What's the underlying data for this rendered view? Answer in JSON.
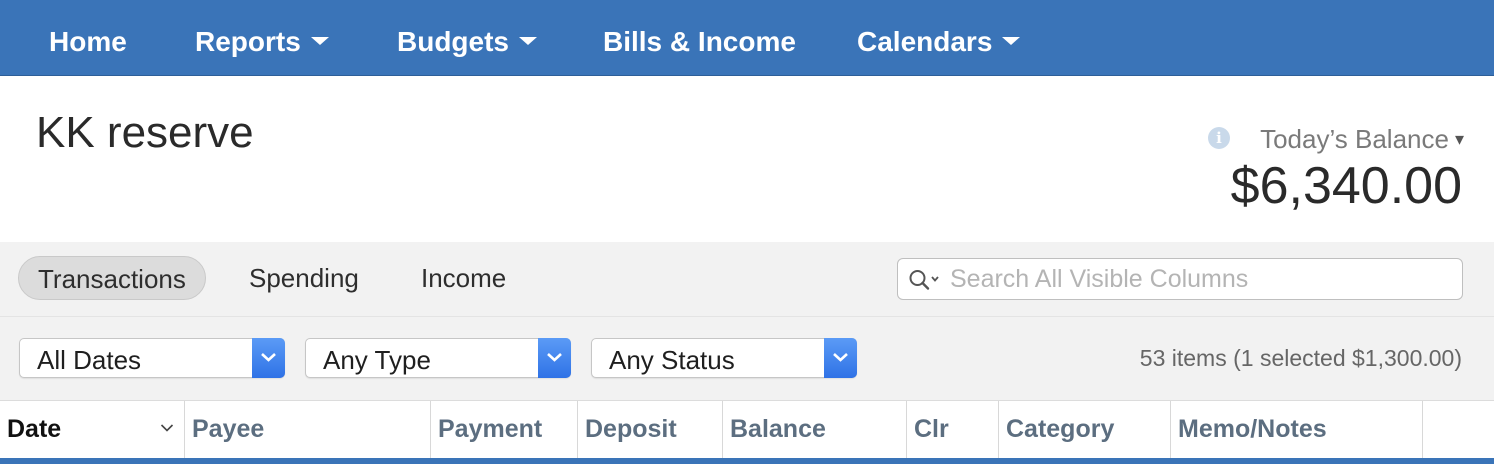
{
  "nav": {
    "items": [
      {
        "label": "Home",
        "has_dropdown": false
      },
      {
        "label": "Reports",
        "has_dropdown": true
      },
      {
        "label": "Budgets",
        "has_dropdown": true
      },
      {
        "label": "Bills & Income",
        "has_dropdown": false
      },
      {
        "label": "Calendars",
        "has_dropdown": true
      }
    ],
    "background": "#3a74b8"
  },
  "header": {
    "account_name": "KK reserve",
    "balance_label": "Today’s Balance",
    "balance_value": "$6,340.00",
    "info_icon": "info-icon"
  },
  "tabs": [
    {
      "label": "Transactions",
      "active": true
    },
    {
      "label": "Spending",
      "active": false
    },
    {
      "label": "Income",
      "active": false
    }
  ],
  "search": {
    "placeholder": "Search All Visible Columns",
    "value": "",
    "icon": "search-icon"
  },
  "filters": {
    "dates": {
      "selected": "All Dates"
    },
    "type": {
      "selected": "Any Type"
    },
    "status": {
      "selected": "Any Status"
    },
    "summary": "53 items (1 selected $1,300.00)"
  },
  "table": {
    "columns": [
      "Date",
      "Payee",
      "Payment",
      "Deposit",
      "Balance",
      "Clr",
      "Category",
      "Memo/Notes"
    ],
    "sorted_column": "Date",
    "sort_direction": "descending"
  },
  "colors": {
    "accent": "#3a74b8",
    "select_button": "#2f72e6"
  }
}
